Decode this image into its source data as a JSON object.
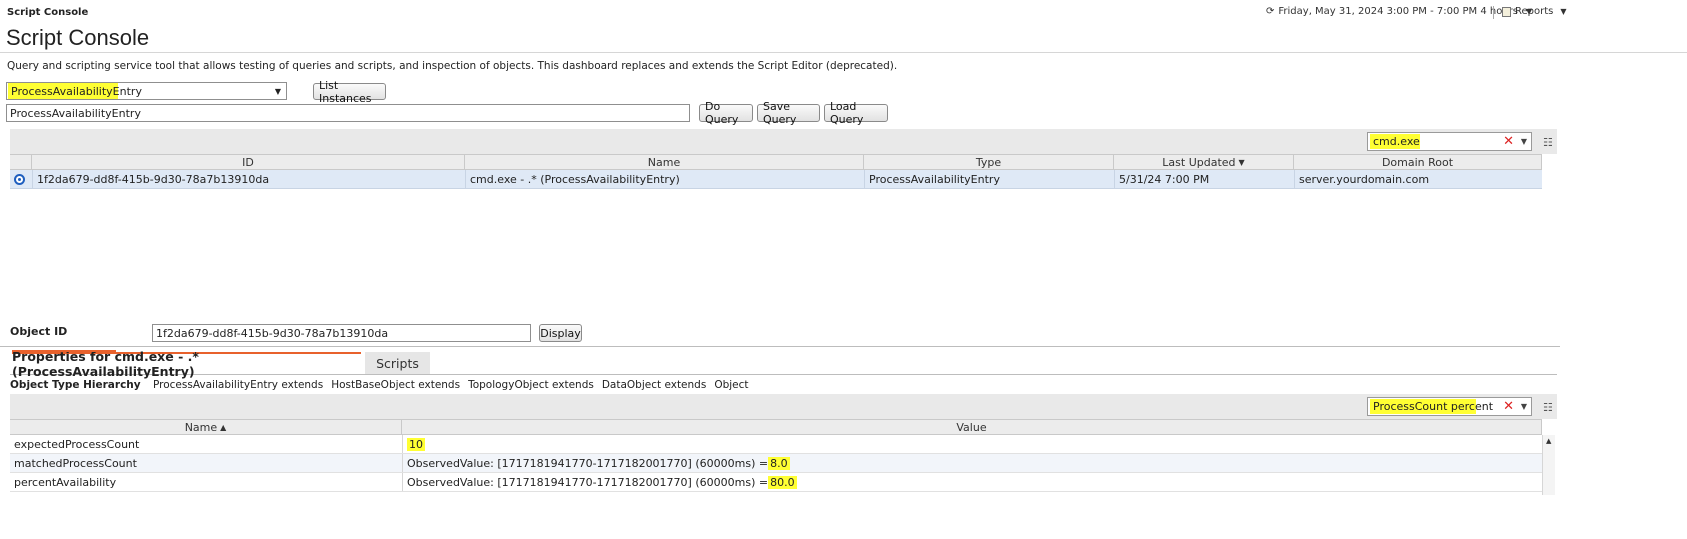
{
  "header": {
    "app_title": "Script Console",
    "time_icon": "clock-range-icon",
    "time_range": "Friday, May 31, 2024 3:00 PM - 7:00 PM 4 hours",
    "reports_label": "Reports",
    "reports_icon": "report-icon"
  },
  "page": {
    "title": "Script Console",
    "description": "Query and scripting service tool that allows testing of queries and scripts, and inspection of objects. This dashboard replaces and extends the Script Editor (deprecated)."
  },
  "query": {
    "type_select_value": "ProcessAvailabilityEntry",
    "list_instances_label": "List Instances",
    "query_value": "ProcessAvailabilityEntry",
    "do_query_label": "Do Query",
    "save_query_label": "Save Query",
    "load_query_label": "Load Query"
  },
  "instances_grid": {
    "filter_value": "cmd.exe",
    "columns": [
      "ID",
      "Name",
      "Type",
      "Last Updated",
      "Domain Root"
    ],
    "sort_column": "Last Updated",
    "rows": [
      {
        "id": "1f2da679-dd8f-415b-9d30-78a7b13910da",
        "name": "cmd.exe - .* (ProcessAvailabilityEntry)",
        "type": "ProcessAvailabilityEntry",
        "last_updated": "5/31/24 7:00 PM",
        "domain_root": "server.yourdomain.com"
      }
    ]
  },
  "object": {
    "label": "Object ID",
    "value": "1f2da679-dd8f-415b-9d30-78a7b13910da",
    "display_label": "Display"
  },
  "tabs": {
    "properties_label": "Properties for cmd.exe - .* (ProcessAvailabilityEntry)",
    "scripts_label": "Scripts"
  },
  "hierarchy": {
    "label": "Object Type Hierarchy",
    "items": [
      "ProcessAvailabilityEntry extends",
      "HostBaseObject extends",
      "TopologyObject extends",
      "DataObject extends",
      "Object"
    ]
  },
  "properties_grid": {
    "filter_value": "ProcessCount percent",
    "columns": [
      "Name",
      "Value"
    ],
    "sort_column": "Name",
    "rows": [
      {
        "name": "expectedProcessCount",
        "value_prefix": "",
        "value_highlight": "10"
      },
      {
        "name": "matchedProcessCount",
        "value_prefix": "ObservedValue: [1717181941770-1717182001770] (60000ms) = ",
        "value_highlight": "8.0"
      },
      {
        "name": "percentAvailability",
        "value_prefix": "ObservedValue: [1717181941770-1717182001770] (60000ms) = ",
        "value_highlight": "80.0"
      }
    ]
  },
  "colors": {
    "highlight": "#ffff33",
    "selected_row": "#dfe9f6",
    "tab_accent": "#e8612c",
    "radio_blue": "#1f5fbf"
  }
}
